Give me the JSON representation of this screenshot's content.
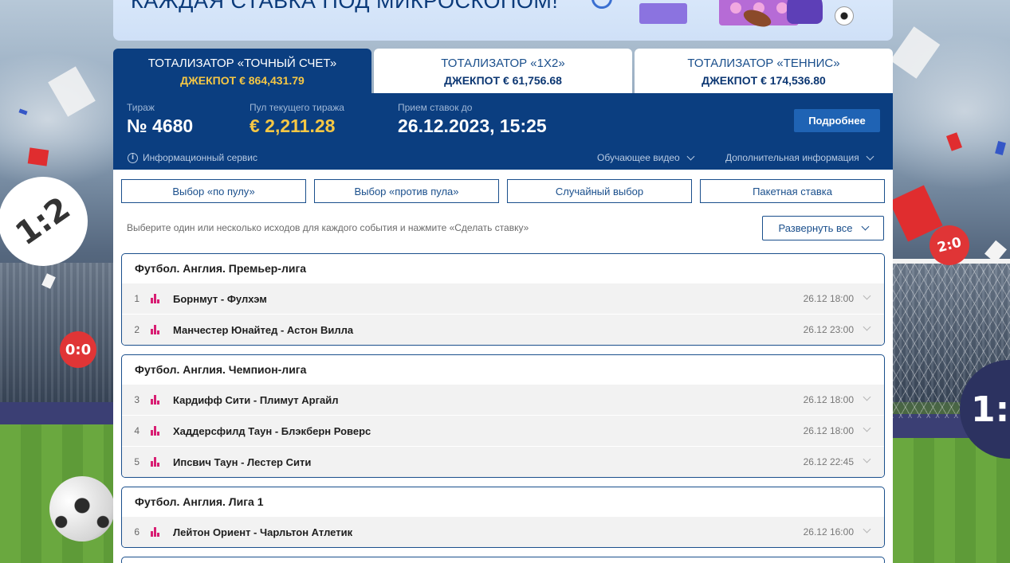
{
  "banner": {
    "text": "КАЖДАЯ СТАВКА ПОД МИКРОСКОПОМ!"
  },
  "background": {
    "scores": [
      "1:2",
      "0:0",
      "2:0",
      "1:"
    ]
  },
  "tabs": [
    {
      "title": "ТОТАЛИЗАТОР «ТОЧНЫЙ СЧЕТ»",
      "jackpot": "ДЖЕКПОТ € 864,431.79",
      "active": true
    },
    {
      "title": "ТОТАЛИЗАТОР «1Х2»",
      "jackpot": "ДЖЕКПОТ € 61,756.68",
      "active": false
    },
    {
      "title": "ТОТАЛИЗАТОР «ТЕННИС»",
      "jackpot": "ДЖЕКПОТ € 174,536.80",
      "active": false
    }
  ],
  "info": {
    "draw_label": "Тираж",
    "draw_value": "№ 4680",
    "pool_label": "Пул текущего тиража",
    "pool_value": "€ 2,211.28",
    "deadline_label": "Прием ставок до",
    "deadline_value": "26.12.2023, 15:25",
    "more_button": "Подробнее",
    "service_label": "Информационный сервис",
    "video_label": "Обучающее видео",
    "extra_label": "Дополнительная информация"
  },
  "modes": [
    "Выбор «по пулу»",
    "Выбор «против пула»",
    "Случайный выбор",
    "Пакетная ставка"
  ],
  "hint": "Выберите один или несколько исходов для каждого события и нажмите «Сделать ставку»",
  "expand_label": "Развернуть все",
  "groups": [
    {
      "title": "Футбол. Англия. Премьер-лига",
      "matches": [
        {
          "num": "1",
          "name": "Борнмут - Фулхэм",
          "time": "26.12 18:00"
        },
        {
          "num": "2",
          "name": "Манчестер Юнайтед - Астон Вилла",
          "time": "26.12 23:00"
        }
      ]
    },
    {
      "title": "Футбол. Англия. Чемпион-лига",
      "matches": [
        {
          "num": "3",
          "name": "Кардифф Сити - Плимут Аргайл",
          "time": "26.12 18:00"
        },
        {
          "num": "4",
          "name": "Хаддерсфилд Таун - Блэкберн Роверс",
          "time": "26.12 18:00"
        },
        {
          "num": "5",
          "name": "Ипсвич Таун - Лестер Сити",
          "time": "26.12 22:45"
        }
      ]
    },
    {
      "title": "Футбол. Англия. Лига 1",
      "matches": [
        {
          "num": "6",
          "name": "Лейтон Ориент - Чарльтон Атлетик",
          "time": "26.12 16:00"
        }
      ]
    }
  ],
  "colors": {
    "brand_dark": "#0b3e80",
    "accent_gold": "#f6c744",
    "stats_pink": "#d81e73",
    "button_blue": "#1f63b4"
  }
}
